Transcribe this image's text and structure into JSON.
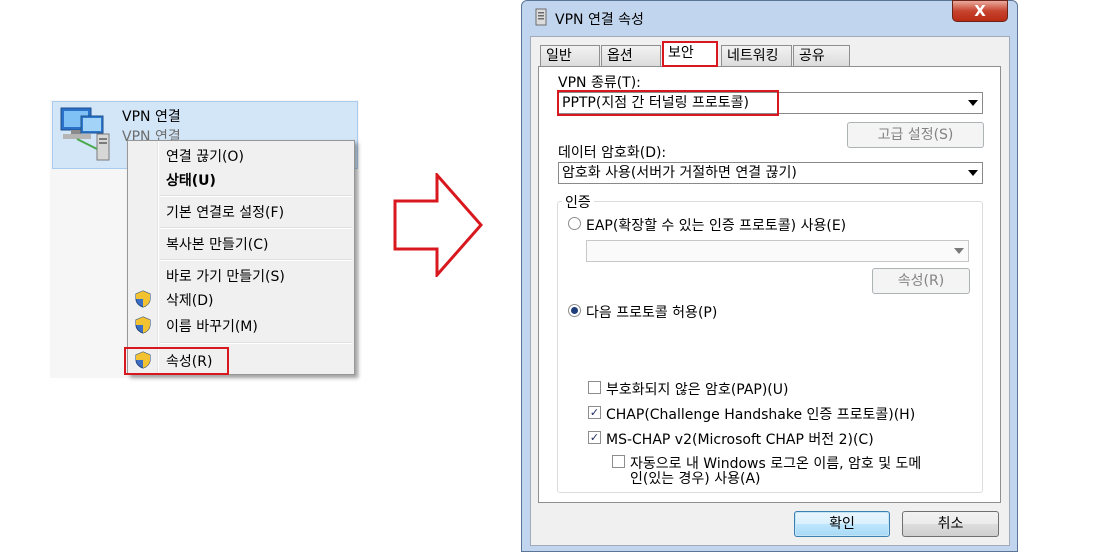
{
  "connection": {
    "name": "VPN 연결",
    "subtitle": "VPN 연결",
    "icon": "network-connection-icon"
  },
  "context_menu": {
    "items": [
      {
        "label": "연결 끊기(O)",
        "bold": false,
        "shield": false
      },
      {
        "label": "상태(U)",
        "bold": true,
        "shield": false
      },
      {
        "label": "기본 연결로 설정(F)",
        "bold": false,
        "shield": false
      },
      {
        "label": "복사본 만들기(C)",
        "bold": false,
        "shield": false
      },
      {
        "label": "바로 가기 만들기(S)",
        "bold": false,
        "shield": false
      },
      {
        "label": "삭제(D)",
        "bold": false,
        "shield": true
      },
      {
        "label": "이름 바꾸기(M)",
        "bold": false,
        "shield": true
      },
      {
        "label": "속성(R)",
        "bold": false,
        "shield": true
      }
    ]
  },
  "dialog": {
    "title": "VPN 연결 속성",
    "close_glyph": "X",
    "tabs": [
      "일반",
      "옵션",
      "보안",
      "네트워킹",
      "공유"
    ],
    "active_tab": "보안",
    "vpn_type_label": "VPN 종류(T):",
    "vpn_type_value": "PPTP(지점 간 터널링 프로토콜)",
    "advanced_button": "고급 설정(S)",
    "encryption_label": "데이터 암호화(D):",
    "encryption_value": "암호화 사용(서버가 거절하면 연결 끊기)",
    "auth_group_label": "인증",
    "eap_radio_label": "EAP(확장할 수 있는 인증 프로토콜) 사용(E)",
    "eap_combo_value": "",
    "properties_button": "속성(R)",
    "allow_protocols_label": "다음 프로토콜 허용(P)",
    "protocols": [
      {
        "label": "부호화되지 않은 암호(PAP)(U)",
        "checked": false
      },
      {
        "label": "CHAP(Challenge Handshake 인증 프로토콜)(H)",
        "checked": true
      },
      {
        "label": "MS-CHAP v2(Microsoft CHAP 버전 2)(C)",
        "checked": true
      }
    ],
    "autologon_line1": "자동으로 내 Windows 로그온 이름, 암호 및 도메",
    "autologon_line2": "인(있는 경우) 사용(A)",
    "autologon_checked": false,
    "ok_button": "확인",
    "cancel_button": "취소"
  },
  "colors": {
    "highlight_red": "#d8181e",
    "selection_blue": "#d3e6f8",
    "dialog_frame": "#c1d6ee"
  }
}
